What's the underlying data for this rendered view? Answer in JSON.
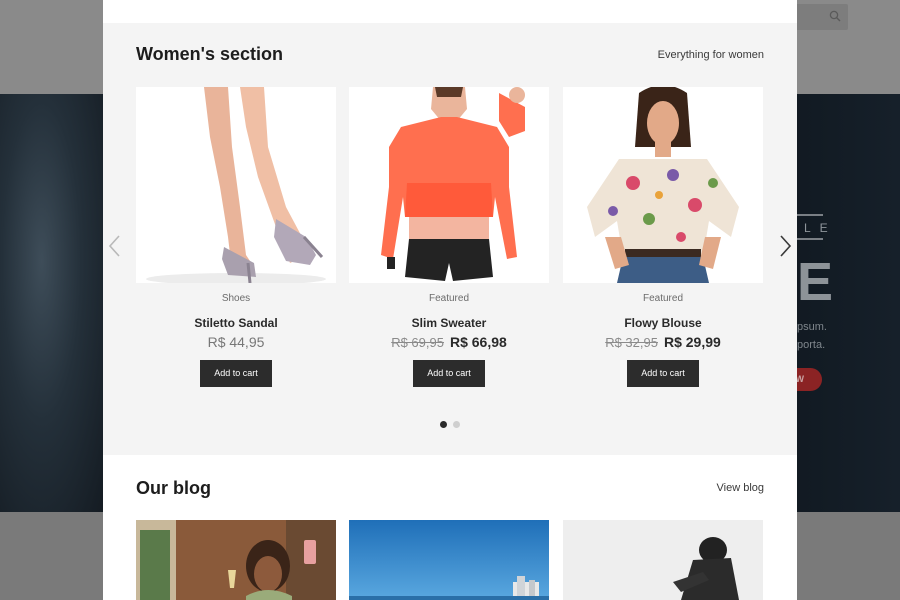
{
  "women_section": {
    "title": "Women's section",
    "link": "Everything for women",
    "products": [
      {
        "category": "Shoes",
        "name": "Stiletto Sandal",
        "old_price": "",
        "price": "R$ 44,95",
        "button": "Add to cart",
        "image_icon": "stiletto-sandal-photo"
      },
      {
        "category": "Featured",
        "name": "Slim Sweater",
        "old_price": "R$ 69,95",
        "price": "R$ 66,98",
        "button": "Add to cart",
        "image_icon": "slim-sweater-photo"
      },
      {
        "category": "Featured",
        "name": "Flowy Blouse",
        "old_price": "R$ 32,95",
        "price": "R$ 29,99",
        "button": "Add to cart",
        "image_icon": "flowy-blouse-photo"
      }
    ],
    "carousel": {
      "pages": 2,
      "active_page": 1
    }
  },
  "blog_section": {
    "title": "Our blog",
    "link": "View blog",
    "posts": [
      {
        "image_icon": "woman-selfie-photo"
      },
      {
        "image_icon": "sea-skyline-photo"
      },
      {
        "image_icon": "motorcycle-rider-photo"
      }
    ]
  },
  "background_page": {
    "hero_letters": "L E",
    "hero_big": "E",
    "hero_text_1": "psum.",
    "hero_text_2": "porta.",
    "hero_button": "W",
    "accent_color": "#8b2324"
  },
  "colors": {
    "button": "#2c2c2c",
    "section_bg": "#f4f4f4",
    "modal_bg": "#ffffff"
  }
}
